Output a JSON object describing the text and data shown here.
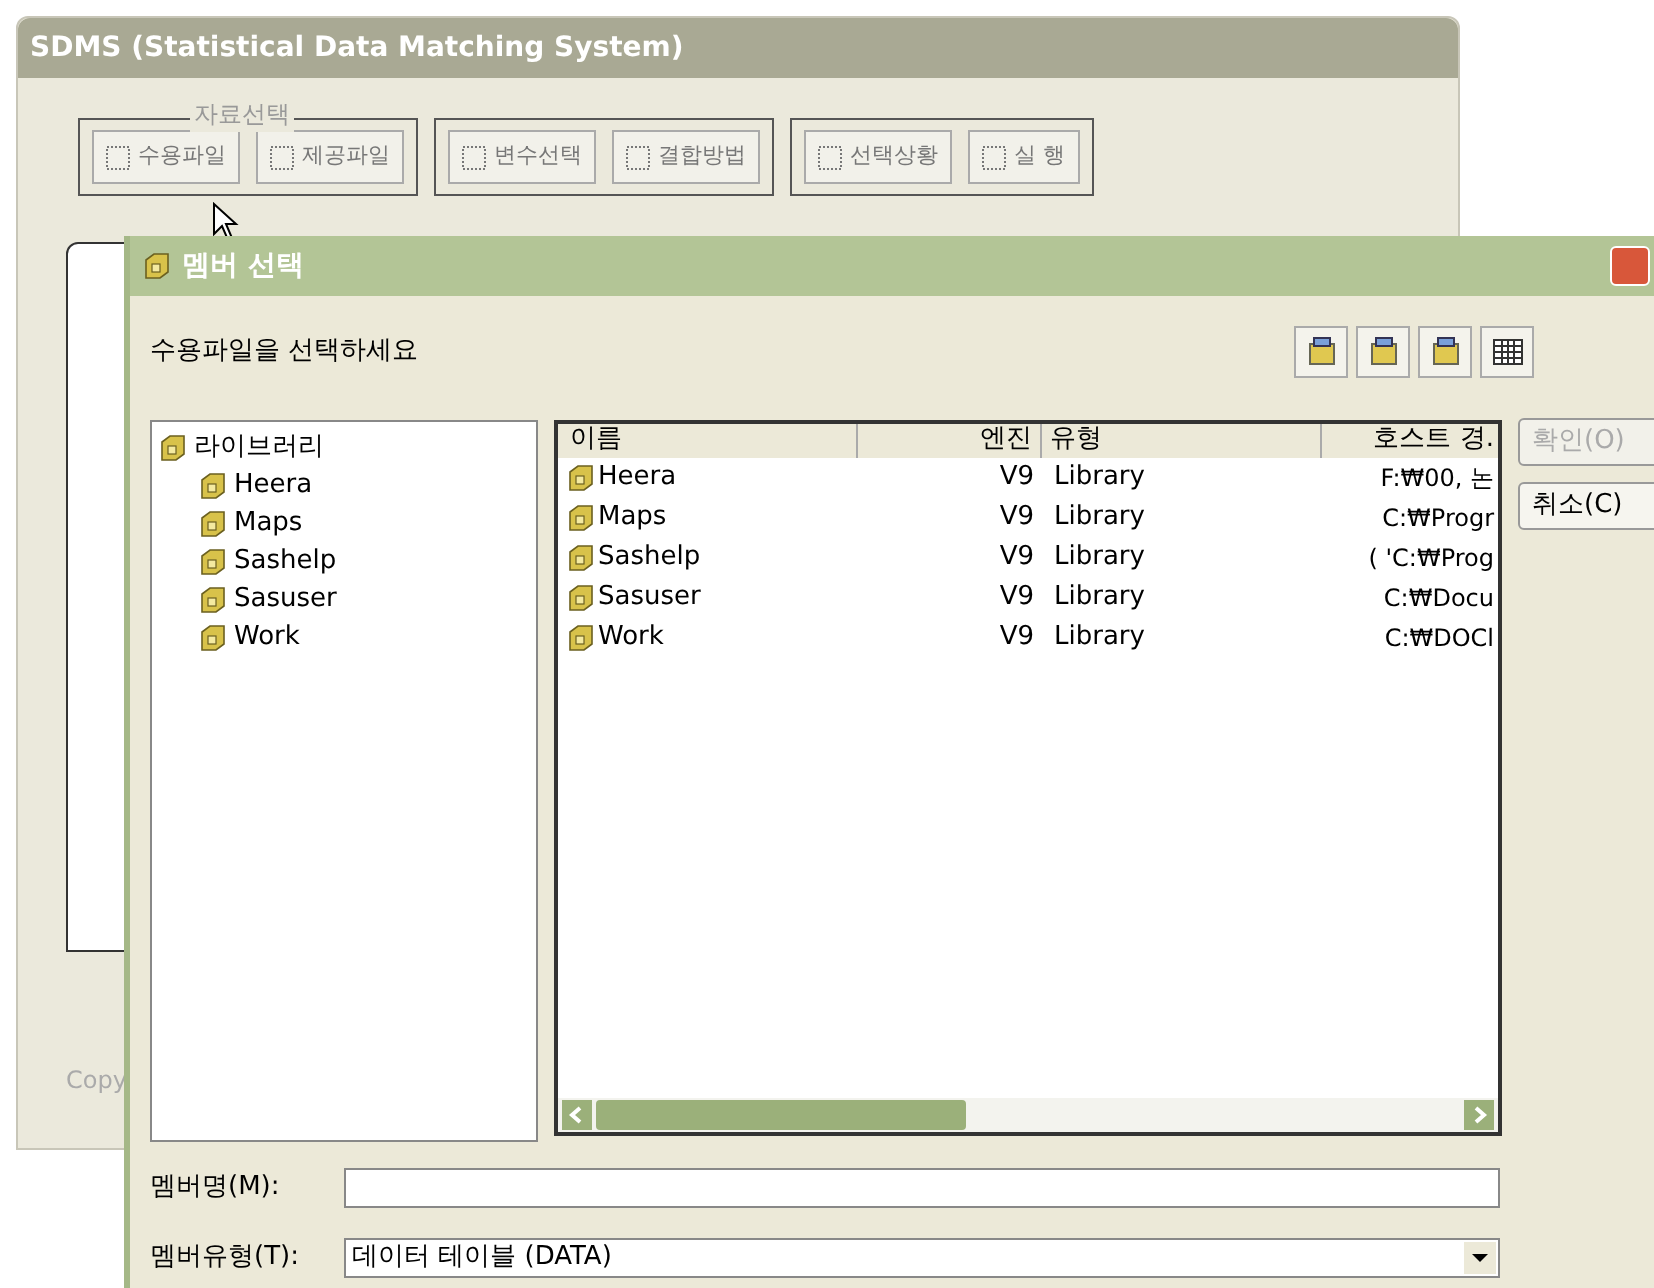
{
  "main_window": {
    "title": "SDMS (Statistical Data Matching System)",
    "group_title": "자료선택",
    "button_groups": [
      [
        "수용파일",
        "제공파일"
      ],
      [
        "변수선택",
        "결합방법"
      ],
      [
        "선택상황",
        "실 행"
      ]
    ],
    "footer": "Copy"
  },
  "dialog": {
    "title": "멤버 선택",
    "prompt": "수용파일을 선택하세요",
    "tree": {
      "label": "라이브러리",
      "expanded": true,
      "children": [
        {
          "label": "Heera"
        },
        {
          "label": "Maps"
        },
        {
          "label": "Sashelp"
        },
        {
          "label": "Sasuser"
        },
        {
          "label": "Work"
        }
      ]
    },
    "table": {
      "columns": [
        "이름",
        "엔진",
        "유형",
        "호스트 경."
      ],
      "rows": [
        [
          "Heera",
          "V9",
          "Library",
          "F:₩00, 논"
        ],
        [
          "Maps",
          "V9",
          "Library",
          "C:₩Progr"
        ],
        [
          "Sashelp",
          "V9",
          "Library",
          "( 'C:₩Prog"
        ],
        [
          "Sasuser",
          "V9",
          "Library",
          "C:₩Docu"
        ],
        [
          "Work",
          "V9",
          "Library",
          "C:₩DOCl"
        ]
      ]
    },
    "buttons": [
      {
        "label": "확인(O)",
        "disabled": true
      },
      {
        "label": "취소(C)",
        "disabled": false
      }
    ],
    "member_name": {
      "label": "멤버명(M):"
    },
    "member_type": {
      "label": "멤버유형(T):",
      "value": "데이터 테이블 (DATA)"
    }
  }
}
